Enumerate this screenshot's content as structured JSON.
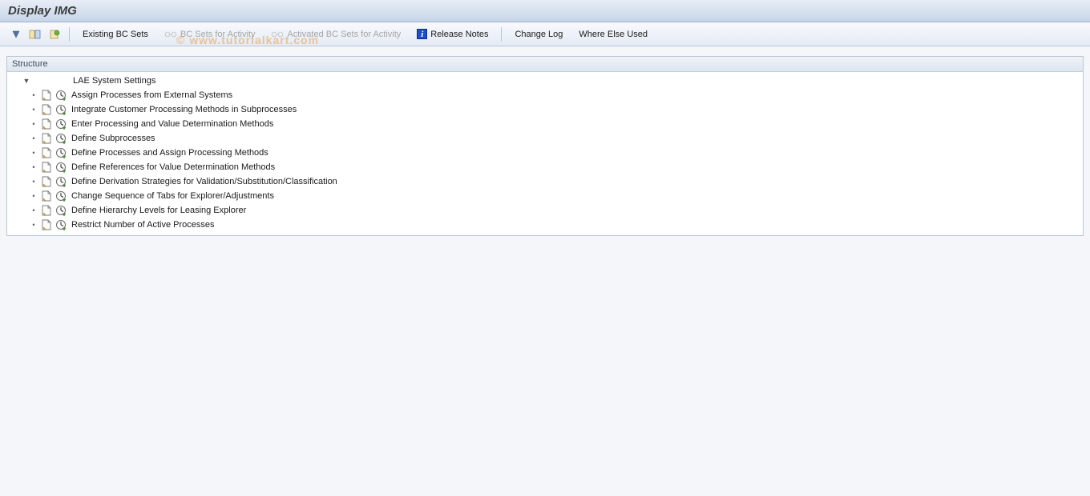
{
  "title": "Display IMG",
  "toolbar": {
    "existing_bc_sets": "Existing BC Sets",
    "bc_sets_for_activity": "BC Sets for Activity",
    "activated_bc_sets_for_activity": "Activated BC Sets for Activity",
    "release_notes": "Release Notes",
    "change_log": "Change Log",
    "where_else_used": "Where Else Used"
  },
  "structure_header": "Structure",
  "tree": {
    "root_label": "LAE System Settings",
    "items": [
      {
        "label": "Assign Processes from External Systems"
      },
      {
        "label": "Integrate Customer Processing Methods in Subprocesses"
      },
      {
        "label": "Enter Processing and Value Determination Methods"
      },
      {
        "label": "Define Subprocesses"
      },
      {
        "label": "Define Processes and Assign Processing Methods"
      },
      {
        "label": "Define References for Value Determination Methods"
      },
      {
        "label": "Define Derivation Strategies for Validation/Substitution/Classification"
      },
      {
        "label": "Change Sequence of Tabs for Explorer/Adjustments"
      },
      {
        "label": "Define Hierarchy Levels for Leasing Explorer"
      },
      {
        "label": "Restrict Number of Active Processes"
      }
    ]
  },
  "watermark": "© www.tutorialkart.com",
  "icons": {
    "info_letter": "i"
  }
}
